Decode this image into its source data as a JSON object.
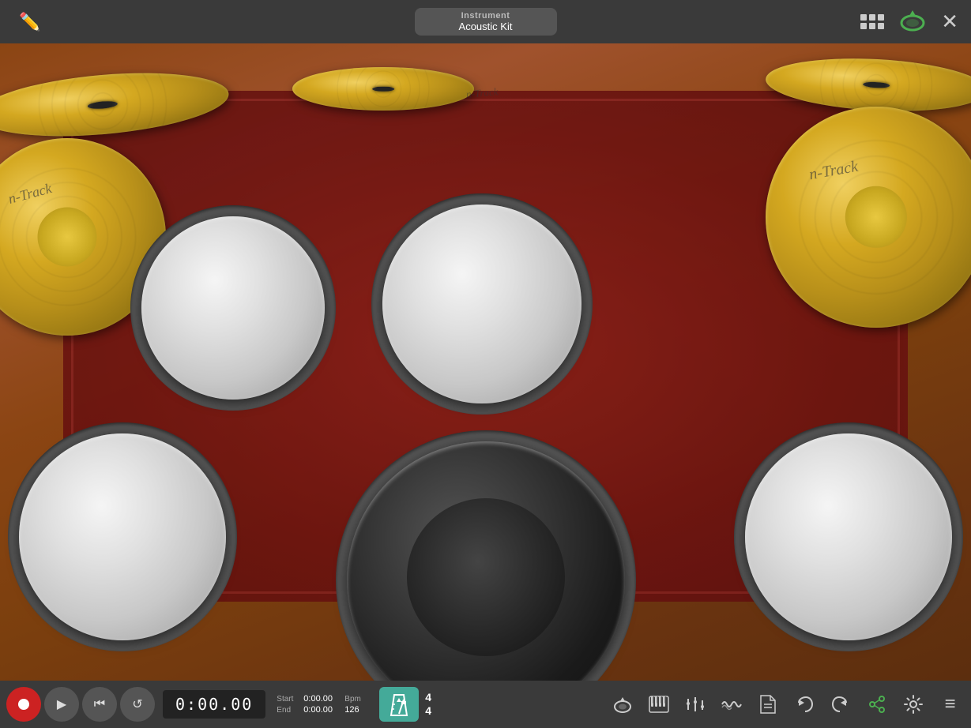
{
  "app": {
    "title": "n-Track",
    "brand": "n-Track"
  },
  "header": {
    "instrument_label": "Instrument",
    "kit_name": "Acoustic Kit",
    "pencil_icon": "✏",
    "close_icon": "✕"
  },
  "drum_kit": {
    "cymbals": [
      "crash-left",
      "hihat",
      "crash-right",
      "ride-left",
      "ride-right"
    ],
    "drums": [
      "tom-left",
      "tom-right",
      "floor-tom-left",
      "floor-tom-right",
      "bass"
    ],
    "ntrack_label": "n-Track"
  },
  "bottom_bar": {
    "record_label": "●",
    "play_label": "▶",
    "rewind_label": "⏮",
    "loop_label": "↺",
    "time": "0:00.00",
    "start_label": "Start",
    "end_label": "End",
    "start_value": "0:00.00",
    "end_value": "0:00.00",
    "bpm_label": "Bpm",
    "bpm_value": "126",
    "time_sig_top": "4",
    "time_sig_bottom": "4",
    "tools": {
      "loop": "🔄",
      "piano": "🎹",
      "mixer": "⚡",
      "waves": "〰",
      "file": "📄",
      "undo": "↩",
      "redo": "↪",
      "share": "share",
      "settings": "⚙",
      "menu": "≡"
    }
  }
}
